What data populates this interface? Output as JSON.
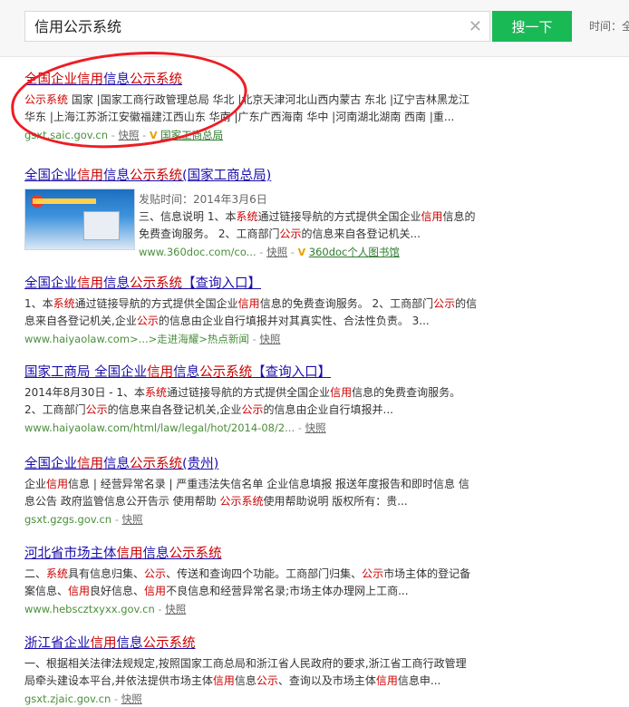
{
  "search": {
    "query": "信用公示系统",
    "button": "搜一下",
    "time_label": "时间：全"
  },
  "results": [
    {
      "title_html": "<em>全国企业</em><em>信用</em>信息<em>公示系统</em>",
      "snippet_html": [
        "<em>公示系统</em> 国家 |国家工商行政管理总局 华北 |北京天津河北山西内蒙古 东北 |辽宁吉林黑龙江",
        "华东 |上海江苏浙江安徽福建江西山东 华南 |广东广西海南 华中 |河南湖北湖南 西南 |重..."
      ],
      "url": "gsxt.saic.gov.cn",
      "cache": "快照",
      "source": "国家工商总局"
    },
    {
      "title_html": "全国企业<em>信用</em>信息<em>公示系统</em>(国家工商总局)",
      "snippet_html": [
        "发贴时间：2014年3月6日",
        "三、信息说明 1、本<em>系统</em>通过链接导航的方式提供全国企业<em>信用</em>信息的",
        "免费查询服务。 2、工商部门<em>公示</em>的信息来自各登记机关..."
      ],
      "url": "www.360doc.com/co...",
      "cache": "快照",
      "source": "360doc个人图书馆"
    },
    {
      "title_html": "全国企业<em>信用</em>信息<em>公示系统</em>【查询入口】",
      "snippet_html": [
        "1、本<em>系统</em>通过链接导航的方式提供全国企业<em>信用</em>信息的免费查询服务。 2、工商部门<em>公示</em>的信",
        "息来自各登记机关,企业<em>公示</em>的信息由企业自行填报并对其真实性、合法性负责。 3..."
      ],
      "url": "www.haiyaolaw.com>...>走进海耀>热点新闻",
      "cache": "快照"
    },
    {
      "title_html": "国家工商局 全国企业<em>信用</em>信息<em>公示系统</em>【查询入口】",
      "snippet_html": [
        "2014年8月30日 - 1、本<em>系统</em>通过链接导航的方式提供全国企业<em>信用</em>信息的免费查询服务。",
        "2、工商部门<em>公示</em>的信息来自各登记机关,企业<em>公示</em>的信息由企业自行填报并..."
      ],
      "url": "www.haiyaolaw.com/html/law/legal/hot/2014-08/2...",
      "cache": "快照"
    },
    {
      "title_html": "全国企业<em>信用</em>信息<em>公示系统</em>(贵州)",
      "snippet_html": [
        "企业<em>信用</em>信息 | 经营异常名录 | 严重违法失信名单 企业信息填报 报送年度报告和即时信息 信",
        "息公告 政府监管信息公开告示 使用帮助 <em>公示系统</em>使用帮助说明 版权所有：贵..."
      ],
      "url": "gsxt.gzgs.gov.cn",
      "cache": "快照"
    },
    {
      "title_html": "河北省市场主体<em>信用</em>信息<em>公示系统</em>",
      "snippet_html": [
        "二、<em>系统</em>具有信息归集、<em>公示</em>、传送和查询四个功能。工商部门归集、<em>公示</em>市场主体的登记备",
        "案信息、<em>信用</em>良好信息、<em>信用</em>不良信息和经营异常名录;市场主体办理网上工商..."
      ],
      "url": "www.hebscztxyxx.gov.cn",
      "cache": "快照"
    },
    {
      "title_html": "浙江省企业<em>信用</em>信息<em>公示系统</em>",
      "snippet_html": [
        "一、根据相关法律法规规定,按照国家工商总局和浙江省人民政府的要求,浙江省工商行政管理",
        "局牵头建设本平台,并依法提供市场主体<em>信用</em>信息<em>公示</em>、查询以及市场主体<em>信用</em>信息申..."
      ],
      "url": "gsxt.zjaic.gov.cn",
      "cache": "快照"
    }
  ]
}
